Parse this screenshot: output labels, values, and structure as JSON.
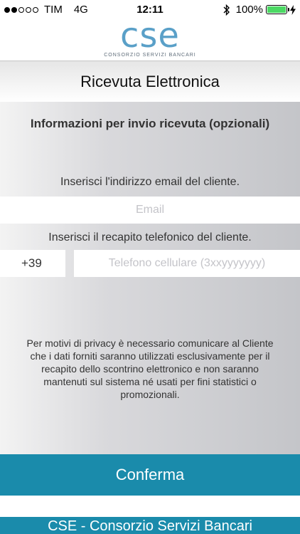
{
  "status_bar": {
    "carrier": "TIM",
    "network": "4G",
    "time": "12:11",
    "battery": "100%",
    "signal_filled": 2,
    "signal_total": 5,
    "battery_color": "#4cd964"
  },
  "logo": {
    "text": "cse",
    "subtitle": "CONSORZIO SERVIZI BANCARI",
    "color": "#5aa0c8"
  },
  "header": {
    "title": "Ricevuta Elettronica"
  },
  "form": {
    "section_title": "Informazioni per invio ricevuta (opzionali)",
    "email_instruction": "Inserisci l'indirizzo email del cliente.",
    "email_placeholder": "Email",
    "phone_instruction": "Inserisci il recapito telefonico del cliente.",
    "phone_prefix": "+39",
    "phone_placeholder": "Telefono cellulare (3xxyyyyyyy)",
    "privacy_notice": "Per motivi di privacy è necessario comunicare al Cliente che i dati forniti saranno utilizzati esclusivamente per il recapito dello scontrino elettronico e non saranno mantenuti sul sistema né usati per fini statistici o promozionali."
  },
  "confirm": {
    "label": "Conferma",
    "color": "#1a8bab"
  },
  "footer": {
    "text": "CSE - Consorzio Servizi Bancari"
  }
}
